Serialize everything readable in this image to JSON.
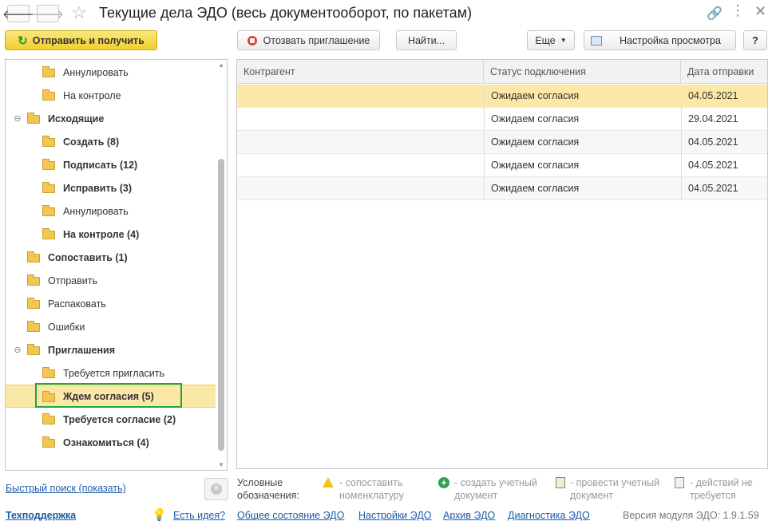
{
  "window": {
    "title": "Текущие дела ЭДО (весь документооборот, по пакетам)"
  },
  "toolbar": {
    "send_receive": "Отправить и получить",
    "revoke_invite": "Отозвать приглашение",
    "find": "Найти...",
    "more": "Еще",
    "view_settings": "Настройка просмотра",
    "help": "?"
  },
  "tree": [
    {
      "label": "Аннулировать",
      "bold": false,
      "level": 2
    },
    {
      "label": "На контроле",
      "bold": false,
      "level": 2
    },
    {
      "label": "Исходящие",
      "bold": true,
      "level": 1,
      "toggle": "⊖"
    },
    {
      "label": "Создать (8)",
      "bold": true,
      "level": 2
    },
    {
      "label": "Подписать (12)",
      "bold": true,
      "level": 2
    },
    {
      "label": "Исправить (3)",
      "bold": true,
      "level": 2
    },
    {
      "label": "Аннулировать",
      "bold": false,
      "level": 2
    },
    {
      "label": "На контроле (4)",
      "bold": true,
      "level": 2
    },
    {
      "label": "Сопоставить (1)",
      "bold": true,
      "level": 1
    },
    {
      "label": "Отправить",
      "bold": false,
      "level": 1
    },
    {
      "label": "Распаковать",
      "bold": false,
      "level": 1
    },
    {
      "label": "Ошибки",
      "bold": false,
      "level": 1
    },
    {
      "label": "Приглашения",
      "bold": true,
      "level": 1,
      "toggle": "⊖"
    },
    {
      "label": "Требуется пригласить",
      "bold": false,
      "level": 2
    },
    {
      "label": "Ждем согласия (5)",
      "bold": true,
      "level": 2,
      "selected": true
    },
    {
      "label": "Требуется согласие (2)",
      "bold": true,
      "level": 2
    },
    {
      "label": "Ознакомиться (4)",
      "bold": true,
      "level": 2
    }
  ],
  "grid": {
    "columns": [
      "Контрагент",
      "Статус подключения",
      "Дата отправки"
    ],
    "rows": [
      {
        "counterparty": "",
        "status": "Ожидаем согласия",
        "date": "04.05.2021",
        "selected": true
      },
      {
        "counterparty": "",
        "status": "Ожидаем согласия",
        "date": "29.04.2021"
      },
      {
        "counterparty": "",
        "status": "Ожидаем согласия",
        "date": "04.05.2021"
      },
      {
        "counterparty": "",
        "status": "Ожидаем согласия",
        "date": "04.05.2021"
      },
      {
        "counterparty": "",
        "status": "Ожидаем согласия",
        "date": "04.05.2021"
      }
    ]
  },
  "bottom": {
    "quick_search": "Быстрый поиск (показать)",
    "legend_title_1": "Условные",
    "legend_title_2": "обозначения:",
    "legend": [
      {
        "icon": "warning-icon",
        "line1": "- сопоставить",
        "line2": "номенклатуру"
      },
      {
        "icon": "plus-circle-icon",
        "line1": "- создать учетный",
        "line2": "документ"
      },
      {
        "icon": "post-document-icon",
        "line1": "- провести учетный",
        "line2": "документ"
      },
      {
        "icon": "no-action-icon",
        "line1": "- действий не",
        "line2": "требуется"
      }
    ]
  },
  "footer": {
    "support": "Техподдержка",
    "links": [
      "Есть идея?",
      "Общее состояние ЭДО",
      "Настройки ЭДО",
      "Архив ЭДО",
      "Диагностика ЭДО"
    ],
    "version": "Версия модуля ЭДО: 1.9.1.59"
  },
  "colors": {
    "accent_yellow": "#f0cf2b",
    "selection": "#fbe8a6",
    "highlight_box": "#1fa644",
    "link": "#1a5aa5"
  }
}
